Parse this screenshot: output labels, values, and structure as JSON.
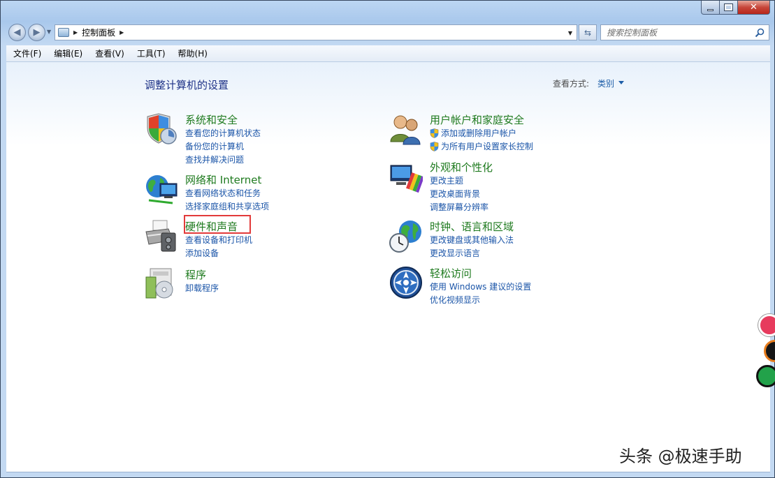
{
  "window": {
    "min_label": "",
    "close_label": "✕"
  },
  "address": {
    "path": "控制面板"
  },
  "search": {
    "placeholder": "搜索控制面板"
  },
  "menu": [
    "文件(F)",
    "编辑(E)",
    "查看(V)",
    "工具(T)",
    "帮助(H)"
  ],
  "page": {
    "title": "调整计算机的设置",
    "view_by_label": "查看方式:",
    "view_by_value": "类别"
  },
  "categories": {
    "system_security": {
      "title": "系统和安全",
      "links": [
        "查看您的计算机状态",
        "备份您的计算机",
        "查找并解决问题"
      ]
    },
    "network": {
      "title": "网络和 Internet",
      "links": [
        "查看网络状态和任务",
        "选择家庭组和共享选项"
      ]
    },
    "hardware": {
      "title": "硬件和声音",
      "links": [
        "查看设备和打印机",
        "添加设备"
      ]
    },
    "programs": {
      "title": "程序",
      "links": [
        "卸载程序"
      ]
    },
    "users": {
      "title": "用户帐户和家庭安全",
      "links": [
        "添加或删除用户帐户",
        "为所有用户设置家长控制"
      ]
    },
    "appearance": {
      "title": "外观和个性化",
      "links": [
        "更改主题",
        "更改桌面背景",
        "调整屏幕分辨率"
      ]
    },
    "clock": {
      "title": "时钟、语言和区域",
      "links": [
        "更改键盘或其他输入法",
        "更改显示语言"
      ]
    },
    "ease": {
      "title": "轻松访问",
      "links": [
        "使用 Windows 建议的设置",
        "优化视频显示"
      ]
    }
  },
  "watermark": "头条 @极速手助",
  "colors": {
    "title_green": "#1e7a1e",
    "link_blue": "#1b55a8",
    "highlight_red": "#e23a3a"
  }
}
